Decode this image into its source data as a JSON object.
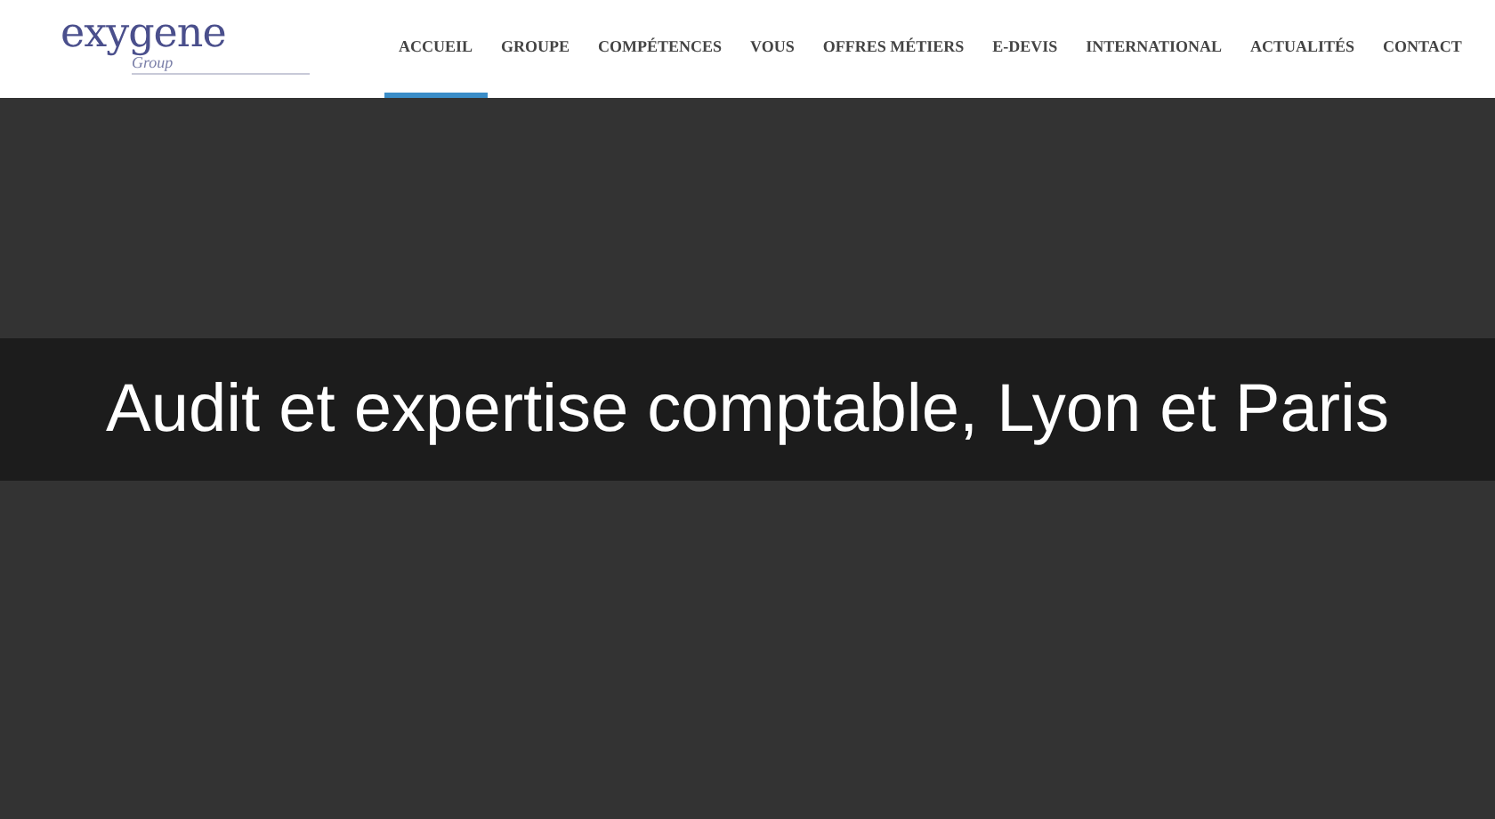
{
  "logo": {
    "name": "exygene",
    "subtitle": "Group"
  },
  "nav": [
    {
      "label": "ACCUEIL",
      "selected": true
    },
    {
      "label": "GROUPE",
      "selected": false
    },
    {
      "label": "COMPÉTENCES",
      "selected": false
    },
    {
      "label": "VOUS",
      "selected": false
    },
    {
      "label": "OFFRES MÉTIERS",
      "selected": false
    },
    {
      "label": "E-DEVIS",
      "selected": false
    },
    {
      "label": "INTERNATIONAL",
      "selected": false
    },
    {
      "label": "ACTUALITÉS",
      "selected": false
    },
    {
      "label": "CONTACT",
      "selected": false
    }
  ],
  "banner": {
    "title": "Audit et expertise comptable, Lyon et Paris"
  }
}
